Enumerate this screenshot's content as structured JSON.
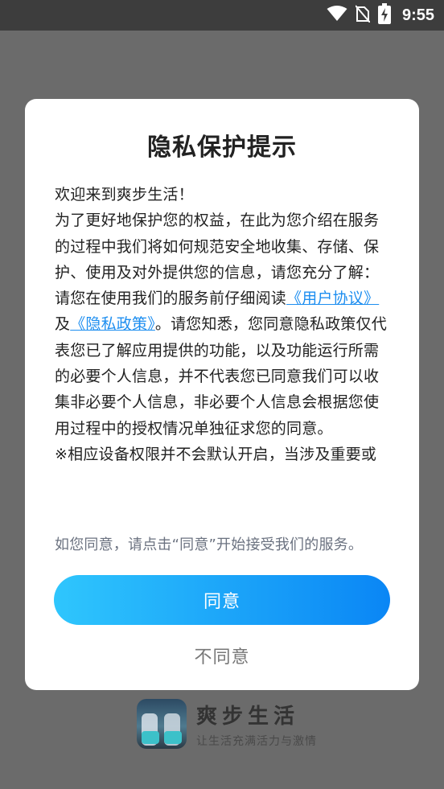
{
  "status_bar": {
    "time": "9:55"
  },
  "dialog": {
    "title": "隐私保护提示",
    "body": {
      "line_welcome": "欢迎来到爽步生活！",
      "para_intro": "为了更好地保护您的权益，在此为您介绍在服务的过程中我们将如何规范安全地收集、存储、保护、使用及对外提供您的信息，请您充分了解：",
      "read_prefix": "请您在使用我们的服务前仔细阅读",
      "user_agreement_link": "《用户协议》",
      "and_text": "及",
      "privacy_policy_link": "《隐私政策》",
      "read_suffix": "。请您知悉，您同意隐私政策仅代表您已了解应用提供的功能，以及功能运行所需的必要个人信息，并不代表您已同意我们可以收集非必要个人信息，非必要个人信息会根据您使用过程中的授权情况单独征求您的同意。",
      "para_permissions": "※相应设备权限并不会默认开启，当涉及重要或"
    },
    "consent_note": "如您同意，请点击“同意”开始接受我们的服务。",
    "agree_label": "同意",
    "disagree_label": "不同意"
  },
  "brand": {
    "name": "爽步生活",
    "slogan": "让生活充满活力与激情"
  },
  "colors": {
    "link": "#1d8ef0",
    "button_gradient_start": "#2fc6fd",
    "button_gradient_end": "#0a86f5",
    "overlay": "#6b6b6b"
  },
  "icons": [
    "wifi-icon",
    "no-sim-icon",
    "battery-charging-icon"
  ]
}
